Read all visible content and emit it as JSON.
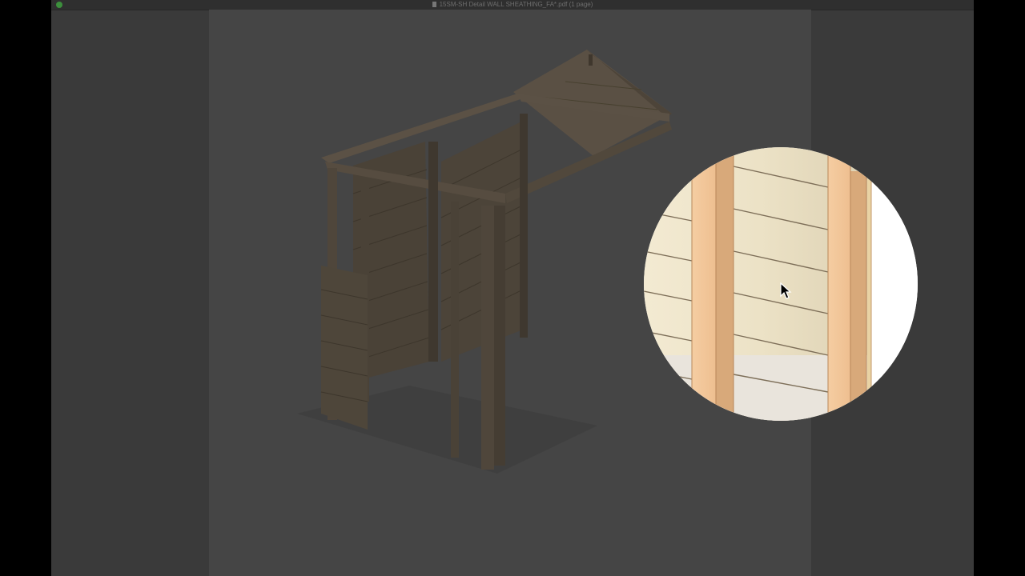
{
  "window": {
    "title": "15SM-SH Detail WALL SHEATHING_FA*.pdf (1 page)"
  },
  "colors": {
    "desktop": "#000000",
    "window_bg": "#3a3a3a",
    "page_dimmed": "#454545",
    "frame_lumber": "#52473a",
    "sheathing": "#e8dcc0",
    "stud": "#f2c79a",
    "stud_edge": "#d8a97a",
    "floor": "#e8e3dc"
  },
  "icons": {
    "close": "close-icon",
    "document": "document-icon",
    "cursor": "arrow-cursor-icon"
  }
}
